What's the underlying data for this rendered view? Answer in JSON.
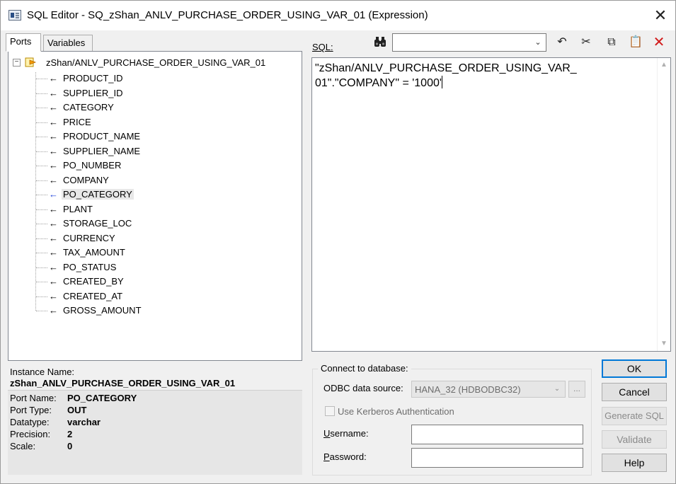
{
  "window": {
    "title": "SQL Editor - SQ_zShan_ANLV_PURCHASE_ORDER_USING_VAR_01 (Expression)",
    "close_glyph": "✕"
  },
  "tabs": [
    {
      "label": "Ports",
      "active": true
    },
    {
      "label": "Variables",
      "active": false
    }
  ],
  "tree": {
    "root": "zShan/ANLV_PURCHASE_ORDER_USING_VAR_01",
    "expander_glyph": "−",
    "arrow_glyph": "←",
    "items": [
      "PRODUCT_ID",
      "SUPPLIER_ID",
      "CATEGORY",
      "PRICE",
      "PRODUCT_NAME",
      "SUPPLIER_NAME",
      "PO_NUMBER",
      "COMPANY",
      "PO_CATEGORY",
      "PLANT",
      "STORAGE_LOC",
      "CURRENCY",
      "TAX_AMOUNT",
      "PO_STATUS",
      "CREATED_BY",
      "CREATED_AT",
      "GROSS_AMOUNT"
    ],
    "selected": "PO_CATEGORY"
  },
  "info": {
    "instance_label": "Instance Name:",
    "instance_value": "zShan_ANLV_PURCHASE_ORDER_USING_VAR_01",
    "rows": [
      {
        "key": "Port Name:",
        "value": "PO_CATEGORY"
      },
      {
        "key": "Port Type:",
        "value": "OUT"
      },
      {
        "key": "Datatype:",
        "value": "varchar"
      },
      {
        "key": "Precision:",
        "value": "2"
      },
      {
        "key": "Scale:",
        "value": "0"
      }
    ]
  },
  "sql": {
    "label": "SQL:",
    "search_value": "",
    "text": "\"zShan/ANLV_PURCHASE_ORDER_USING_VAR_\n01\".\"COMPANY\" = '1000'"
  },
  "toolbar": {
    "combo_glyph": "⌄",
    "undo_glyph": "↶",
    "cut_glyph": "✂",
    "copy_glyph": "⧉",
    "paste_glyph": "📋",
    "delete_glyph": "✕"
  },
  "scroll": {
    "up_glyph": "▲",
    "down_glyph": "▼"
  },
  "connect": {
    "group_title": "Connect to database:",
    "odbc_label": "ODBC data source:",
    "odbc_value": "HANA_32 (HDBODBC32)",
    "dropdown_glyph": "⌄",
    "dots_label": "...",
    "kerberos_label": "Use Kerberos Authentication",
    "username_label": "Username:",
    "password_label": "Password:",
    "username_value": "",
    "password_value": ""
  },
  "buttons": {
    "ok": "OK",
    "cancel": "Cancel",
    "generate_sql": "Generate SQL",
    "validate": "Validate",
    "help": "Help"
  },
  "colors": {
    "accent": "#0078d7",
    "selected_arrow": "#1a3fd8",
    "delete_red": "#d11a1a"
  }
}
